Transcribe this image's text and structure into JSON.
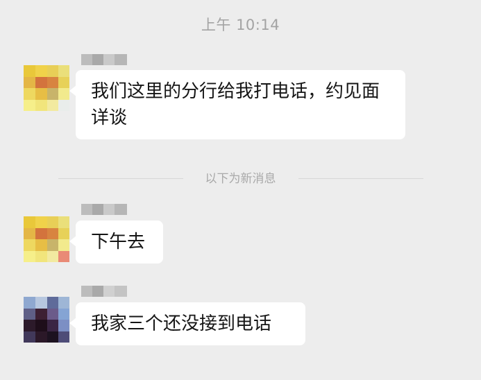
{
  "chat": {
    "timestamp": "上午 10:14",
    "divider_label": "以下为新消息",
    "messages": [
      {
        "text": "我们这里的分行给我打电话，约见面详谈"
      },
      {
        "text": "下午去"
      },
      {
        "text": "我家三个还没接到电话"
      }
    ]
  },
  "colors": {
    "background": "#ededed",
    "bubble": "#ffffff",
    "meta_text": "#a3a3a3"
  }
}
